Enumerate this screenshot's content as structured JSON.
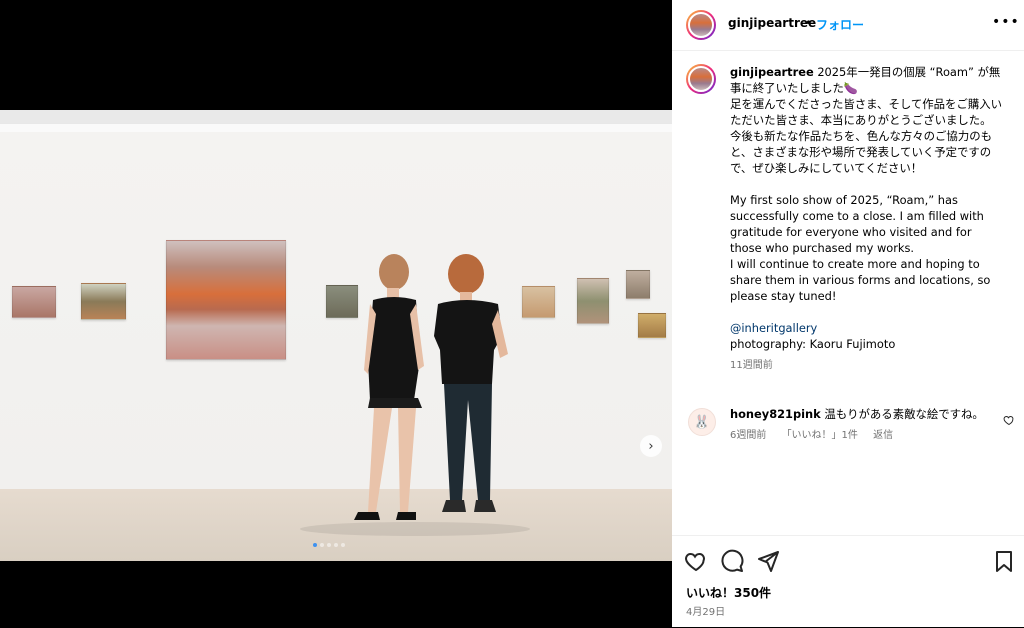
{
  "post": {
    "username": "ginjipeartree",
    "separator": "•",
    "follow_label": "フォロー",
    "more_label": "•••"
  },
  "caption": {
    "username": "ginjipeartree",
    "jp_line1": "2025年一発目の個展 “Roam” が無事に終了いたしました🍆",
    "jp_line2": "足を運んでくださった皆さま、そして作品をご購入いただいた皆さま、本当にありがとうございました。",
    "jp_line3": "今後も新たな作品たちを、色んな方々のご協力のもと、さまざまな形や場所で発表していく予定ですので、ぜひ楽しみにしていてください！",
    "en_line1": "My first solo show of 2025, “Roam,” has successfully come to a close. I am filled with gratitude for everyone who visited and for those who purchased my works.",
    "en_line2": "I will continue to create more and hoping to share them in various forms and locations, so please stay tuned!",
    "mention": "@inheritgallery",
    "photo_credit": "photography: Kaoru Fujimoto",
    "time_ago": "11週間前"
  },
  "comment": {
    "username": "honey821pink",
    "text": "温もりがある素敵な絵ですね。",
    "time_ago": "6週間前",
    "likes_label": "「いいね！」1件",
    "reply_label": "返信"
  },
  "footer": {
    "likes": "いいね！350件",
    "date": "4月29日"
  },
  "carousel": {
    "total_slides": 5,
    "active_slide": 1
  },
  "colors": {
    "accent": "#0095f6",
    "mention": "#00376b",
    "muted": "#737373"
  },
  "icons": [
    "heart-icon",
    "comment-icon",
    "share-icon",
    "bookmark-icon",
    "chevron-right-icon",
    "more-icon"
  ]
}
